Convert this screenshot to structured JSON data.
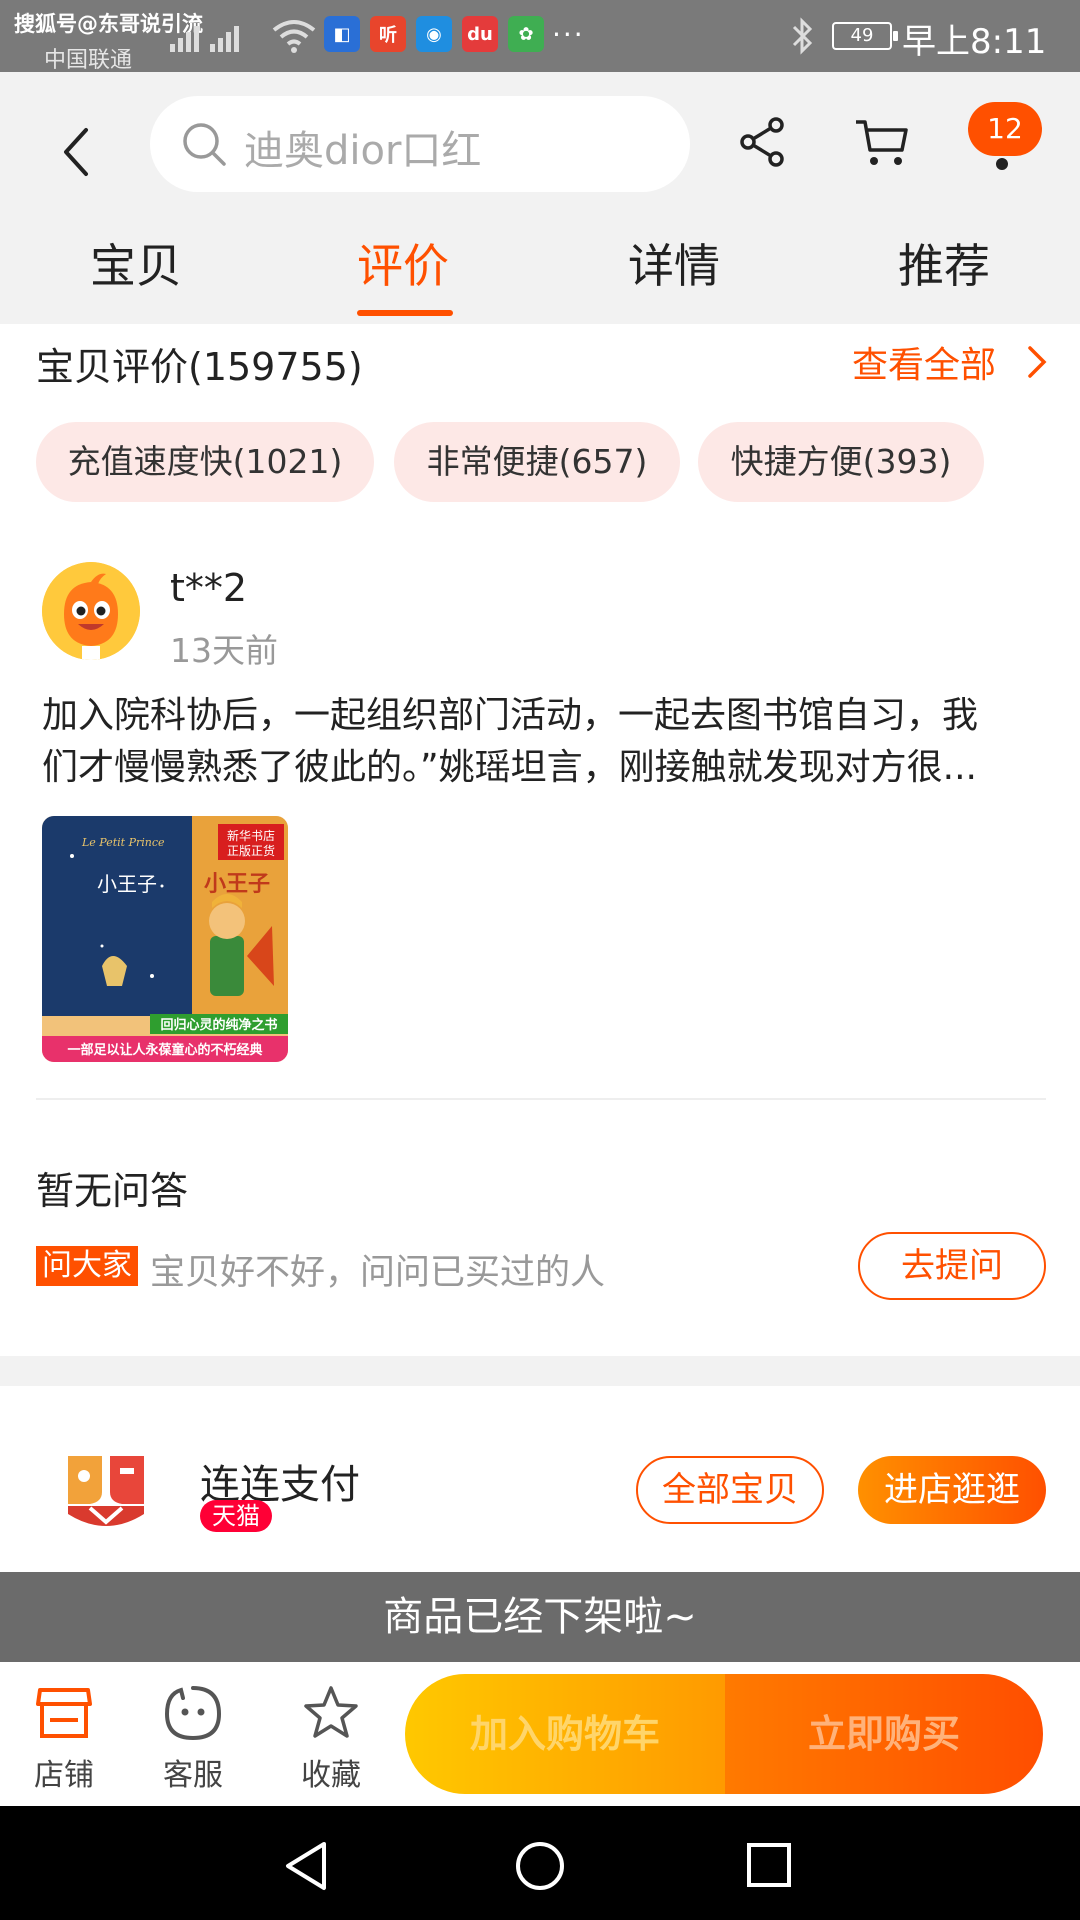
{
  "status_bar": {
    "watermark": "搜狐号@东哥说引流",
    "carrier": "中国联通",
    "battery": "49",
    "time": "早上8:11",
    "more": "···",
    "apps": [
      {
        "name": "app-blue-icon",
        "glyph": "◧",
        "color": "#2a6fd6"
      },
      {
        "name": "app-listen-icon",
        "glyph": "听",
        "color": "#e8452c"
      },
      {
        "name": "app-browser-icon",
        "glyph": "◉",
        "color": "#1f8ee0"
      },
      {
        "name": "app-map-icon",
        "glyph": "du",
        "color": "#e43b3b"
      },
      {
        "name": "app-gallery-icon",
        "glyph": "✿",
        "color": "#3fae52"
      }
    ]
  },
  "header": {
    "search_placeholder": "迪奥dior口红",
    "message_count": "12",
    "tabs": [
      "宝贝",
      "评价",
      "详情",
      "推荐"
    ],
    "active_tab": 1
  },
  "reviews": {
    "title": "宝贝评价(159755)",
    "view_all": "查看全部",
    "tags": [
      "充值速度快(1021)",
      "非常便捷(657)",
      "快捷方便(393)"
    ],
    "item": {
      "username": "t**2",
      "date": "13天前",
      "text_line1": "加入院科协后，一起组织部门活动，一起去图书馆自习，我",
      "text_line2": "们才慢慢熟悉了彼此的。”姚瑶坦言，刚接触就发现对方很...",
      "image": {
        "book_title": "小王子",
        "subtitle_en": "Le Petit Prince",
        "badge_line1": "新华书店",
        "badge_line2": "正版正货",
        "cover_title_right": "小王子",
        "banner1": "回归心灵的纯净之书",
        "banner2": "一部足以让人永葆童心的不朽经典"
      }
    }
  },
  "qa": {
    "title": "暂无问答",
    "badge": "问大家",
    "hint": "宝贝好不好，问问已买过的人",
    "ask_button": "去提问"
  },
  "shop": {
    "name": "连连支付",
    "badge": "天猫",
    "all_items_button": "全部宝贝",
    "enter_button": "进店逛逛"
  },
  "off_shelf_notice": "商品已经下架啦~",
  "bottom_bar": {
    "items": [
      "店铺",
      "客服",
      "收藏"
    ],
    "add_to_cart": "加入购物车",
    "buy_now": "立即购买"
  },
  "colors": {
    "accent": "#ff5000",
    "tmall": "#ff0036",
    "tag_bg": "#fde8e6"
  }
}
